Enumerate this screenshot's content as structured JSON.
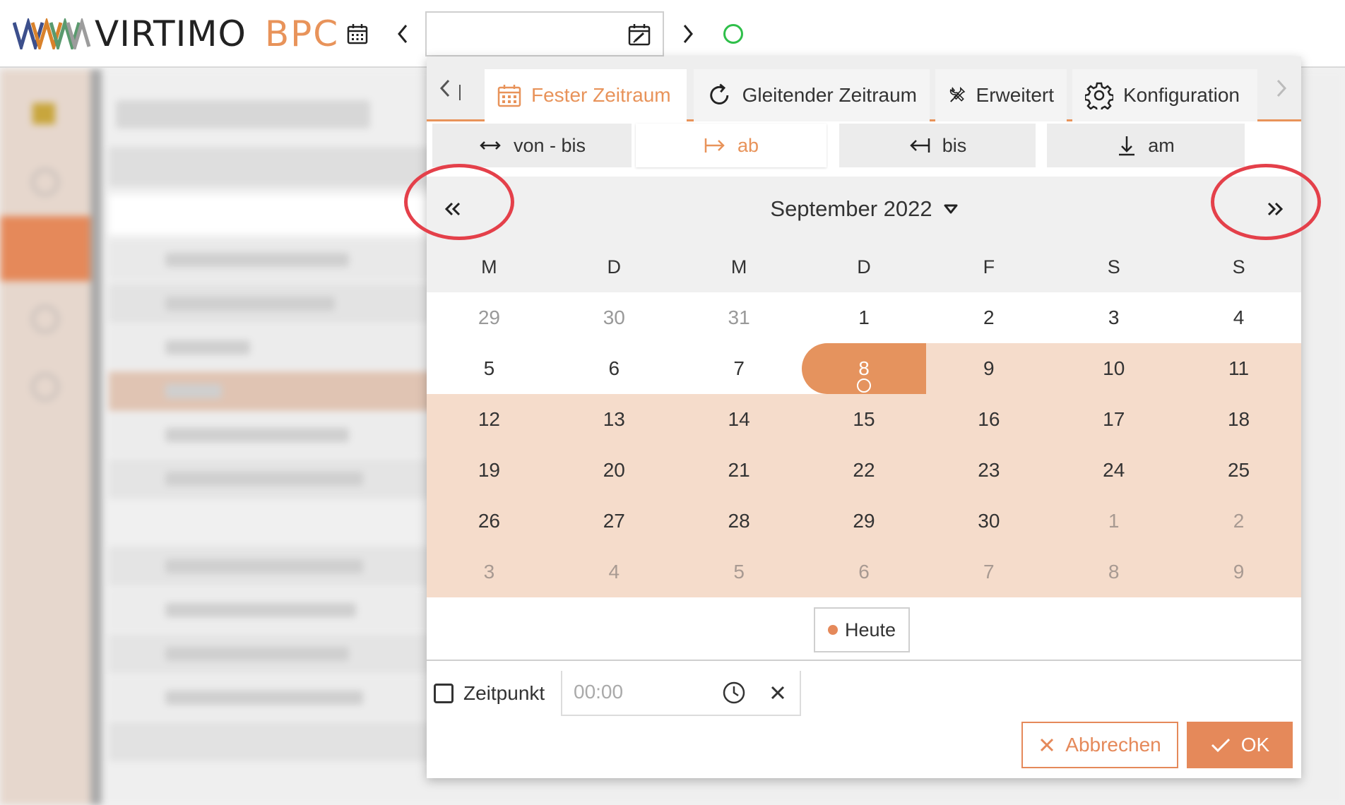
{
  "app": {
    "logo_text": "VIRTIMO",
    "product": "BPC",
    "status_color": "#2fbf4a"
  },
  "date_input": {
    "value": ""
  },
  "popup": {
    "tabs": [
      {
        "label": "Fester Zeitraum",
        "icon": "calendar-grid-icon",
        "active": true
      },
      {
        "label": "Gleitender Zeitraum",
        "icon": "refresh-icon",
        "active": false
      },
      {
        "label": "Erweitert",
        "icon": "tools-icon",
        "active": false
      },
      {
        "label": "Konfiguration",
        "icon": "gear-icon",
        "active": false
      }
    ],
    "modes": [
      {
        "label": "von - bis",
        "icon": "double-arrow-icon",
        "active": false
      },
      {
        "label": "ab",
        "icon": "arrow-right-bar-icon",
        "active": true
      },
      {
        "label": "bis",
        "icon": "arrow-left-bar-icon",
        "active": false
      },
      {
        "label": "am",
        "icon": "arrow-down-icon",
        "active": false
      }
    ],
    "calendar": {
      "month_label": "September 2022",
      "weekdays": [
        "M",
        "D",
        "M",
        "D",
        "F",
        "S",
        "S"
      ],
      "weeks": [
        [
          "29",
          "30",
          "31",
          "1",
          "2",
          "3",
          "4"
        ],
        [
          "5",
          "6",
          "7",
          "8",
          "9",
          "10",
          "11"
        ],
        [
          "12",
          "13",
          "14",
          "15",
          "16",
          "17",
          "18"
        ],
        [
          "19",
          "20",
          "21",
          "22",
          "23",
          "24",
          "25"
        ],
        [
          "26",
          "27",
          "28",
          "29",
          "30",
          "1",
          "2"
        ],
        [
          "3",
          "4",
          "5",
          "6",
          "7",
          "8",
          "9"
        ]
      ],
      "selected_day": "8",
      "today_label": "Heute"
    },
    "time": {
      "checkbox_label": "Zeitpunkt",
      "checked": false,
      "placeholder": "00:00",
      "value": ""
    },
    "buttons": {
      "cancel": "Abbrechen",
      "ok": "OK"
    }
  },
  "colors": {
    "accent": "#e5895a",
    "range": "#f5dccb",
    "annotation": "#e4404a"
  }
}
